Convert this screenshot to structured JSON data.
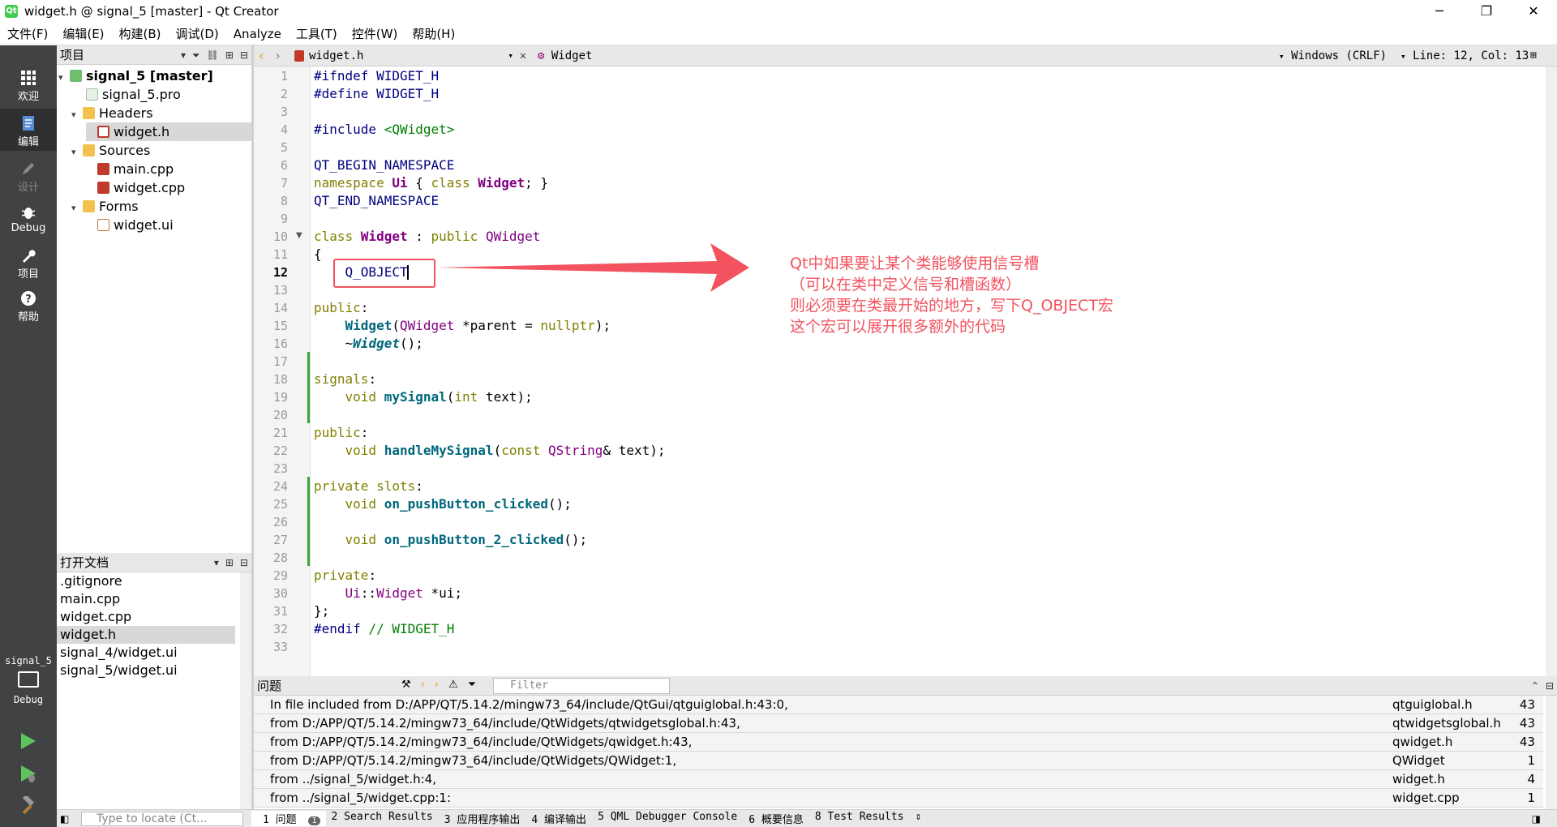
{
  "window": {
    "title": "widget.h @ signal_5 [master] - Qt Creator",
    "app_icon": "Qt",
    "controls": [
      "─",
      "❐",
      "✕"
    ]
  },
  "menu": [
    "文件(F)",
    "编辑(E)",
    "构建(B)",
    "调试(D)",
    "Analyze",
    "工具(T)",
    "控件(W)",
    "帮助(H)"
  ],
  "modes": [
    {
      "label": "欢迎",
      "icon": "grid-icon"
    },
    {
      "label": "编辑",
      "icon": "edit-icon"
    },
    {
      "label": "设计",
      "icon": "pencil-icon"
    },
    {
      "label": "Debug",
      "icon": "bug-icon"
    },
    {
      "label": "项目",
      "icon": "wrench-icon"
    },
    {
      "label": "帮助",
      "icon": "help-icon"
    }
  ],
  "kit": {
    "project": "signal_5",
    "mode": "Debug"
  },
  "project_pane": {
    "title": "项目",
    "tree": [
      {
        "label": "signal_5 [master]",
        "depth": 0,
        "expanded": true,
        "bold": true
      },
      {
        "label": "signal_5.pro",
        "depth": 1
      },
      {
        "label": "Headers",
        "depth": 1,
        "expanded": true
      },
      {
        "label": "widget.h",
        "depth": 2,
        "selected": true
      },
      {
        "label": "Sources",
        "depth": 1,
        "expanded": true
      },
      {
        "label": "main.cpp",
        "depth": 2
      },
      {
        "label": "widget.cpp",
        "depth": 2
      },
      {
        "label": "Forms",
        "depth": 1,
        "expanded": true
      },
      {
        "label": "widget.ui",
        "depth": 2
      }
    ]
  },
  "open_docs": {
    "title": "打开文档",
    "items": [
      ".gitignore",
      "main.cpp",
      "widget.cpp",
      "widget.h",
      "signal_4/widget.ui",
      "signal_5/widget.ui"
    ],
    "selected": "widget.h"
  },
  "editor_bar": {
    "file": "widget.h",
    "symbol": "Widget",
    "eol": "Windows (CRLF)",
    "position": "Line: 12, Col: 13"
  },
  "code": {
    "current_line": 12,
    "lines": [
      [
        [
          "#ifndef WIDGET_H",
          "pp"
        ]
      ],
      [
        [
          "#define WIDGET_H",
          "pp"
        ]
      ],
      [],
      [
        [
          "#include ",
          "pp"
        ],
        [
          "<QWidget>",
          "str"
        ]
      ],
      [],
      [
        [
          "QT_BEGIN_NAMESPACE",
          "mac"
        ]
      ],
      [
        [
          "namespace ",
          "kw"
        ],
        [
          "Ui",
          "tyb"
        ],
        [
          " { ",
          ""
        ],
        [
          "class ",
          "kw"
        ],
        [
          "Widget",
          "tyb"
        ],
        [
          "; }",
          ""
        ]
      ],
      [
        [
          "QT_END_NAMESPACE",
          "mac"
        ]
      ],
      [],
      [
        [
          "class ",
          "kw"
        ],
        [
          "Widget",
          "tyb"
        ],
        [
          " : ",
          ""
        ],
        [
          "public ",
          "kw"
        ],
        [
          "QWidget",
          "ty"
        ]
      ],
      [
        [
          "{",
          ""
        ]
      ],
      [
        [
          "    ",
          ""
        ],
        [
          "Q_OBJECT",
          "mac"
        ]
      ],
      [],
      [
        [
          "public",
          "kw"
        ],
        [
          ":",
          ""
        ]
      ],
      [
        [
          "    ",
          ""
        ],
        [
          "Widget",
          "fn"
        ],
        [
          "(",
          ""
        ],
        [
          "QWidget",
          "ty"
        ],
        [
          " *parent = ",
          ""
        ],
        [
          "nullptr",
          "kw"
        ],
        [
          ");",
          ""
        ]
      ],
      [
        [
          "    ~",
          ""
        ],
        [
          "Widget",
          "it"
        ],
        [
          "();",
          ""
        ]
      ],
      [],
      [
        [
          "signals",
          "kw"
        ],
        [
          ":",
          ""
        ]
      ],
      [
        [
          "    ",
          ""
        ],
        [
          "void ",
          "kw"
        ],
        [
          "mySignal",
          "fn"
        ],
        [
          "(",
          ""
        ],
        [
          "int ",
          "kw"
        ],
        [
          "text);",
          ""
        ]
      ],
      [],
      [
        [
          "public",
          "kw"
        ],
        [
          ":",
          ""
        ]
      ],
      [
        [
          "    ",
          ""
        ],
        [
          "void ",
          "kw"
        ],
        [
          "handleMySignal",
          "fn"
        ],
        [
          "(",
          ""
        ],
        [
          "const ",
          "kw"
        ],
        [
          "QString",
          "ty"
        ],
        [
          "& text);",
          ""
        ]
      ],
      [],
      [
        [
          "private ",
          "kw"
        ],
        [
          "slots",
          "kw"
        ],
        [
          ":",
          ""
        ]
      ],
      [
        [
          "    ",
          ""
        ],
        [
          "void ",
          "kw"
        ],
        [
          "on_pushButton_clicked",
          "fn"
        ],
        [
          "();",
          ""
        ]
      ],
      [],
      [
        [
          "    ",
          ""
        ],
        [
          "void ",
          "kw"
        ],
        [
          "on_pushButton_2_clicked",
          "fn"
        ],
        [
          "();",
          ""
        ]
      ],
      [],
      [
        [
          "private",
          "kw"
        ],
        [
          ":",
          ""
        ]
      ],
      [
        [
          "    ",
          ""
        ],
        [
          "Ui",
          "ty"
        ],
        [
          "::",
          ""
        ],
        [
          "Widget",
          "ty"
        ],
        [
          " *ui;",
          ""
        ]
      ],
      [
        [
          "};",
          ""
        ]
      ],
      [
        [
          "#endif ",
          "pp"
        ],
        [
          "// WIDGET_H",
          "cm"
        ]
      ],
      []
    ]
  },
  "annotation": {
    "color": "#f2535f",
    "lines": [
      "Qt中如果要让某个类能够使用信号槽",
      "（可以在类中定义信号和槽函数）",
      "则必须要在类最开始的地方，写下Q_OBJECT宏",
      "这个宏可以展开很多额外的代码"
    ]
  },
  "issues_pane": {
    "title": "问题",
    "filter_placeholder": "Filter",
    "rows": [
      {
        "msg": "In file included from D:/APP/QT/5.14.2/mingw73_64/include/QtGui/qtguiglobal.h:43:0,",
        "file": "qtguiglobal.h",
        "line": "43"
      },
      {
        "msg": "from D:/APP/QT/5.14.2/mingw73_64/include/QtWidgets/qtwidgetsglobal.h:43,",
        "file": "qtwidgetsglobal.h",
        "line": "43"
      },
      {
        "msg": "from D:/APP/QT/5.14.2/mingw73_64/include/QtWidgets/qwidget.h:43,",
        "file": "qwidget.h",
        "line": "43"
      },
      {
        "msg": "from D:/APP/QT/5.14.2/mingw73_64/include/QtWidgets/QWidget:1,",
        "file": "QWidget",
        "line": "1"
      },
      {
        "msg": "from ../signal_5/widget.h:4,",
        "file": "widget.h",
        "line": "4"
      },
      {
        "msg": "from ../signal_5/widget.cpp:1:",
        "file": "widget.cpp",
        "line": "1"
      }
    ]
  },
  "status": {
    "locate_placeholder": "Type to locate (Ct...",
    "tabs": [
      "1 问题",
      "2 Search Results",
      "3 应用程序输出",
      "4 编译输出",
      "5 QML Debugger Console",
      "6 概要信息",
      "8 Test Results"
    ],
    "issue_count": "1"
  }
}
